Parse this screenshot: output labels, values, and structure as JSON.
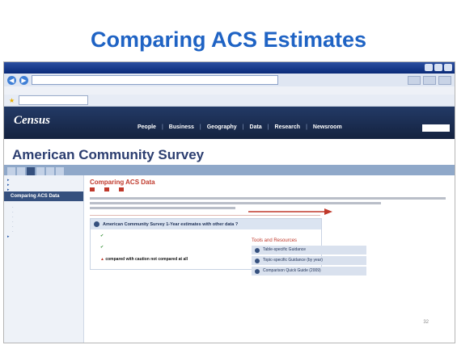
{
  "slide": {
    "title": "Comparing ACS Estimates",
    "number": "32",
    "arrow_color": "#c0392b"
  },
  "browser": {
    "window_title": "",
    "url": "",
    "menu": [],
    "tab_label": ""
  },
  "census_site": {
    "logo": "Census",
    "nav": [
      "People",
      "Business",
      "Geography",
      "Data",
      "Research",
      "Newsroom"
    ],
    "page_title": "American Community Survey",
    "site_tabs": [],
    "active_tab_index": 2,
    "sidebar_active": "Comparing ACS Data",
    "main_heading": "Comparing ACS Data",
    "box_heading": "American Community Survey 1-Year estimates with other data ?",
    "checks": [],
    "warning": {
      "text": "",
      "emphasis_1": "compared with caution",
      "emphasis_2": "not compared at all"
    },
    "tools_title": "Tools and Resources",
    "tools": [
      "Table-specific Guidance",
      "Topic-specific Guidance (by year)",
      "Comparison Quick Guide (2009)"
    ]
  }
}
